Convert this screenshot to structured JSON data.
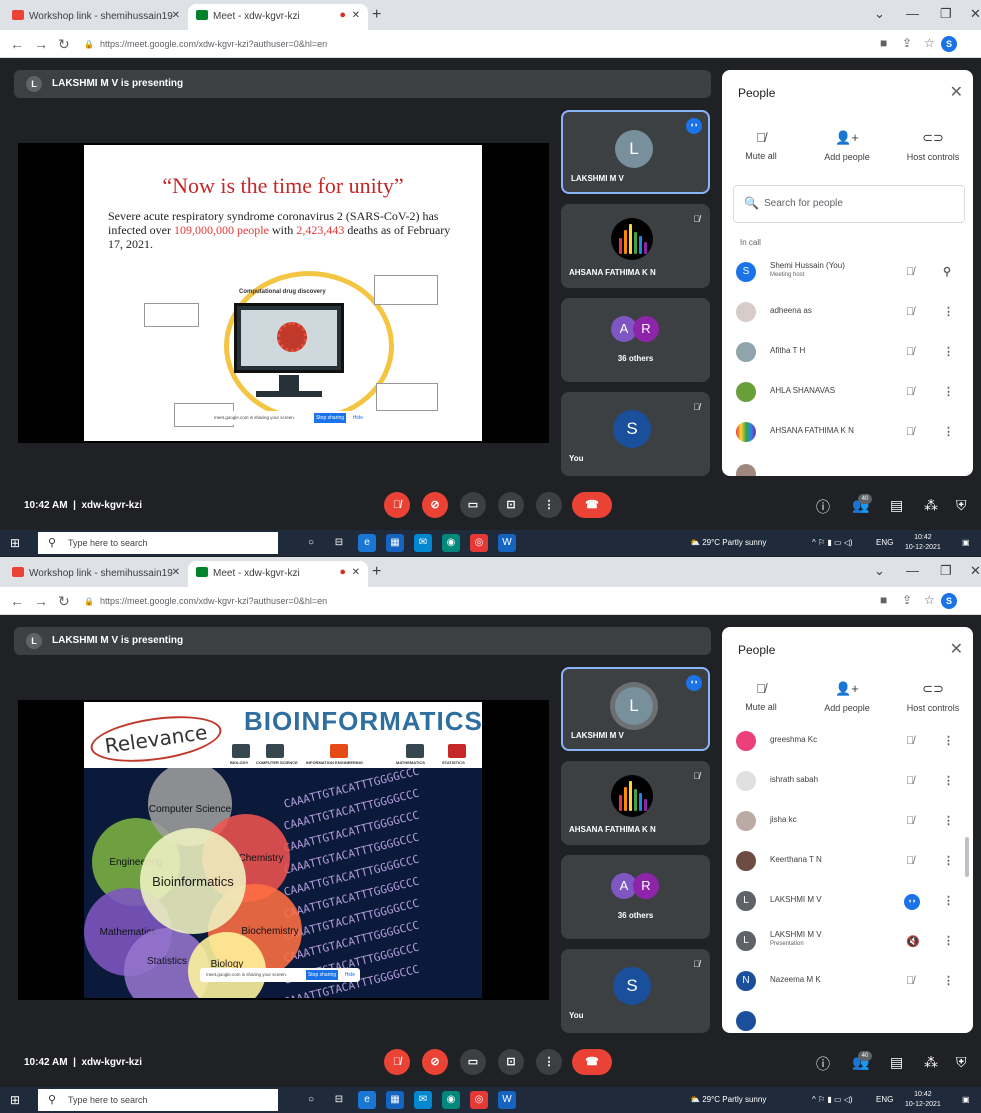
{
  "shots": [
    {
      "browser": {
        "tab1": "Workshop link - shemihussain19",
        "tab2": "Meet - xdw-kgvr-kzi",
        "url": "https://meet.google.com/xdw-kgvr-kzi?authuser=0&hl=en",
        "profile": "S"
      },
      "banner": {
        "initial": "L",
        "text": "LAKSHMI M V is presenting"
      },
      "tiles": {
        "t1": {
          "initial": "L",
          "name": "LAKSHMI M V"
        },
        "t2": {
          "name": "AHSANA FATHIMA K N"
        },
        "t3": {
          "a": "A",
          "b": "R",
          "others": "36 others"
        },
        "t4": {
          "initial": "S",
          "name": "You"
        }
      },
      "panel": {
        "title": "People",
        "mute_all": "Mute all",
        "add_people": "Add people",
        "host_controls": "Host controls",
        "search_placeholder": "Search for people",
        "in_call": "In call",
        "people": [
          {
            "initial": "S",
            "name": "Shemi Hussain (You)",
            "sub": "Meeting host",
            "color": "#1a73e8"
          },
          {
            "name": "adheena as"
          },
          {
            "name": "Afitha T H"
          },
          {
            "name": "AHLA SHANAVAS"
          },
          {
            "name": "AHSANA FATHIMA K N"
          }
        ]
      },
      "bottom": {
        "time": "10:42 AM",
        "sep": "|",
        "code": "xdw-kgvr-kzi",
        "count": "40"
      },
      "taskbar": {
        "search": "Type here to search",
        "weather": "29°C  Partly sunny",
        "lang": "ENG",
        "time": "10:42",
        "date": "10-12-2021"
      }
    },
    {
      "browser": {
        "tab1": "Workshop link - shemihussain19",
        "tab2": "Meet - xdw-kgvr-kzi",
        "url": "https://meet.google.com/xdw-kgvr-kzi?authuser=0&hl=en",
        "profile": "S"
      },
      "banner": {
        "initial": "L",
        "text": "LAKSHMI M V is presenting"
      },
      "tiles": {
        "t1": {
          "initial": "L",
          "name": "LAKSHMI M V"
        },
        "t2": {
          "name": "AHSANA FATHIMA K N"
        },
        "t3": {
          "a": "A",
          "b": "R",
          "others": "36 others"
        },
        "t4": {
          "initial": "S",
          "name": "You"
        }
      },
      "panel": {
        "title": "People",
        "mute_all": "Mute all",
        "add_people": "Add people",
        "host_controls": "Host controls",
        "people": [
          {
            "name": "greeshma Kc"
          },
          {
            "name": "ishrath sabah"
          },
          {
            "name": "jisha kc"
          },
          {
            "name": "Keerthana T N"
          },
          {
            "initial": "L",
            "name": "LAKSHMI M V",
            "color": "#5f6368"
          },
          {
            "initial": "L",
            "name": "LAKSHMI M V",
            "sub": "Presentation",
            "color": "#5f6368"
          },
          {
            "initial": "N",
            "name": "Nazeema M K",
            "color": "#1a4f9c"
          }
        ]
      },
      "bottom": {
        "time": "10:42 AM",
        "sep": "|",
        "code": "xdw-kgvr-kzi",
        "count": "40"
      },
      "taskbar": {
        "search": "Type here to search",
        "weather": "29°C  Partly sunny",
        "lang": "ENG",
        "time": "10:42",
        "date": "10-12-2021"
      }
    }
  ],
  "slide1": {
    "title": "“Now is the time for unity”",
    "body_a": "Severe acute respiratory syndrome coronavirus 2 (SARS-CoV-2) has infected over ",
    "num_people": "109,000,000 people",
    "body_b": " with ",
    "num_deaths": "2,423,443",
    "body_c": " deaths as of February 17, 2021.",
    "diagram_label": "Computational drug discovery"
  },
  "slide2": {
    "relevance": "Relevance",
    "bioinformatics": "BIOINFORMATICS",
    "row_labels": [
      "BIOLOGY",
      "COMPUTER SCIENCE",
      "INFORMATION ENGINEERING",
      "MATHEMATICS",
      "STATISTICS"
    ],
    "circles": {
      "center": "Bioinformatics",
      "cs": "Computer Science",
      "chem": "Chemistry",
      "eng": "Engineering",
      "biochem": "Biochemistry",
      "math": "Mathematics",
      "stats": "Statistics",
      "biology": "Biology"
    },
    "dna": "CAAATTGTACATTTGGGGCCC"
  },
  "share": {
    "text": "meet.google.com is sharing your screen.",
    "stop": "Stop sharing",
    "hide": "Hide"
  },
  "colors": {
    "accent": "#1a73e8",
    "danger": "#ea4335"
  }
}
